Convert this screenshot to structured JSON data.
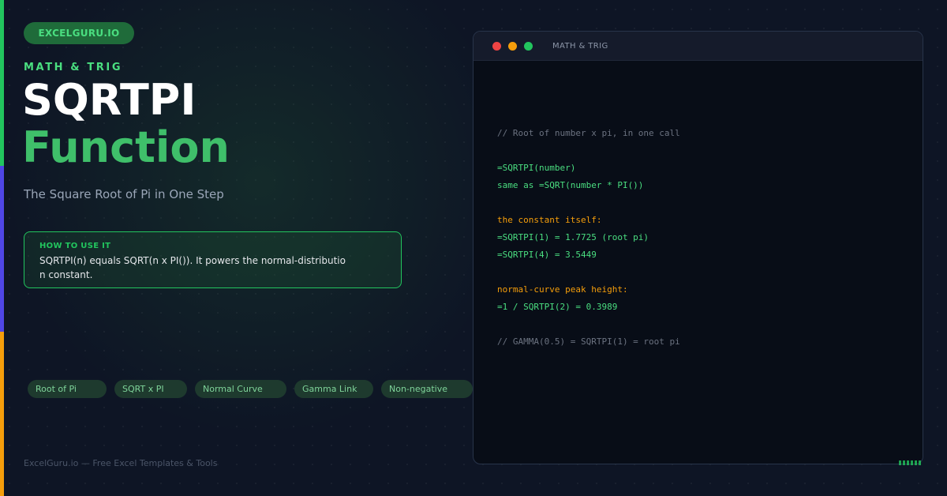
{
  "brand": "EXCELGURU.IO",
  "category": "MATH & TRIG",
  "title": {
    "line1": "SQRTPI",
    "line2": "Function"
  },
  "subtitle": "The Square Root of Pi in One Step",
  "usage": {
    "heading": "HOW TO USE IT",
    "text": "SQRTPI(n) equals SQRT(n x PI()). It powers the normal-distribution constant."
  },
  "tags": [
    "Root of Pi",
    "SQRT x PI",
    "Normal Curve",
    "Gamma Link",
    "Non-negative"
  ],
  "footer": "ExcelGuru.io — Free Excel Templates & Tools",
  "window": {
    "title": "MATH & TRIG",
    "lines": [
      "// Root of number x pi, in one call",
      "=SQRTPI(number)",
      "same as =SQRT(number * PI())",
      "the constant itself:",
      "=SQRTPI(1) = 1.7725 (root pi)",
      "=SQRTPI(4) = 3.5449",
      "normal-curve peak height:",
      "=1 / SQRTPI(2) = 0.3989",
      "// GAMMA(0.5) = SQRTPI(1) = root pi"
    ]
  },
  "colors": {
    "accent_green": "#22c55e",
    "accent_blue": "#4f46e5",
    "accent_orange": "#f59e0b",
    "background": "#0e1525"
  }
}
